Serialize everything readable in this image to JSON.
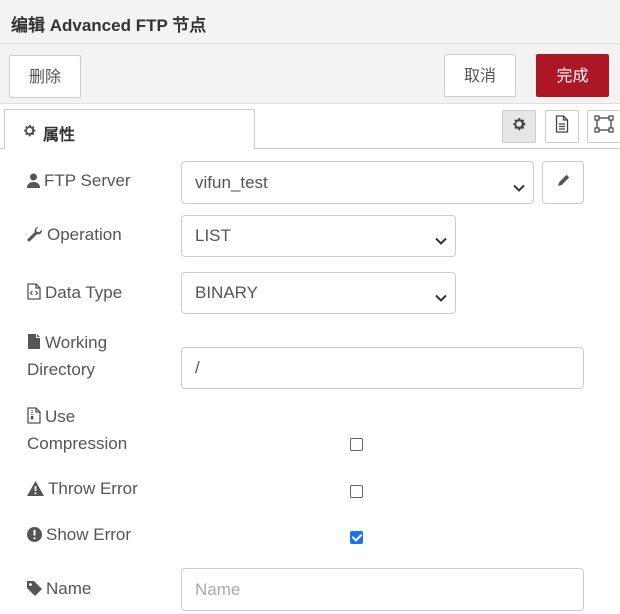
{
  "dialog": {
    "title": "编辑 Advanced FTP 节点"
  },
  "toolbar": {
    "delete_label": "删除",
    "cancel_label": "取消",
    "done_label": "完成"
  },
  "tabs": {
    "properties_label": "属性",
    "properties_icon": "gear-icon"
  },
  "side_buttons": [
    "gear-icon",
    "document-icon",
    "appearance-icon"
  ],
  "form": {
    "ftp_server": {
      "label": "FTP Server",
      "icon": "user-icon",
      "value": "vifun_test"
    },
    "operation": {
      "label": "Operation",
      "icon": "wrench-icon",
      "value": "LIST"
    },
    "data_type": {
      "label": "Data Type",
      "icon": "code-file-icon",
      "value": "BINARY"
    },
    "working_directory": {
      "label_line1": "Working",
      "label_line2": "Directory",
      "icon": "file-icon",
      "value": "/"
    },
    "use_compression": {
      "label_line1": "Use",
      "label_line2": "Compression",
      "icon": "zip-file-icon",
      "checked": false
    },
    "throw_error": {
      "label": "Throw Error",
      "icon": "warning-icon",
      "checked": false
    },
    "show_error": {
      "label": "Show Error",
      "icon": "exclamation-circle-icon",
      "checked": true
    },
    "name": {
      "label": "Name",
      "icon": "tag-icon",
      "value": "",
      "placeholder": "Name"
    }
  },
  "colors": {
    "accent": "#ad1625",
    "checkbox_checked": "#1a73e8"
  }
}
